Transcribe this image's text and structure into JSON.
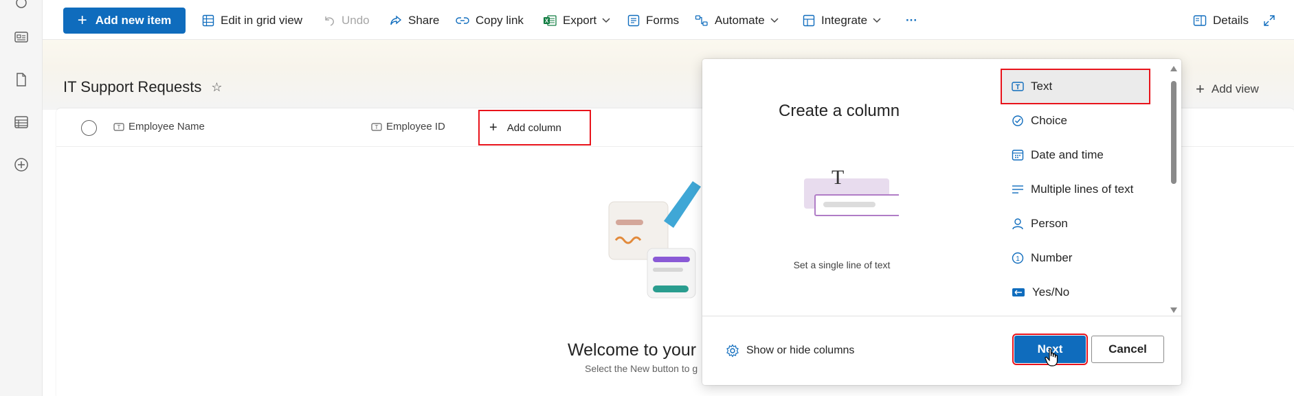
{
  "toolbar": {
    "add_new_item": "Add new item",
    "edit_grid": "Edit in grid view",
    "undo": "Undo",
    "share": "Share",
    "copy_link": "Copy link",
    "export": "Export",
    "forms": "Forms",
    "automate": "Automate",
    "integrate": "Integrate",
    "more": "···",
    "details": "Details"
  },
  "page": {
    "title": "IT Support Requests",
    "add_view": "Add view"
  },
  "list": {
    "columns": [
      "Employee Name",
      "Employee ID"
    ],
    "add_column": "Add column",
    "welcome": "Welcome to your",
    "welcome_sub": "Select the New button to g"
  },
  "panel": {
    "title": "Create a column",
    "description": "Set a single line of text",
    "options": [
      {
        "label": "Text",
        "icon": "text-field-icon",
        "selected": true
      },
      {
        "label": "Choice",
        "icon": "choice-icon"
      },
      {
        "label": "Date and time",
        "icon": "calendar-icon"
      },
      {
        "label": "Multiple lines of text",
        "icon": "multiline-text-icon"
      },
      {
        "label": "Person",
        "icon": "person-icon"
      },
      {
        "label": "Number",
        "icon": "number-icon"
      },
      {
        "label": "Yes/No",
        "icon": "yes-no-icon"
      }
    ],
    "show_hide": "Show or hide columns",
    "next": "Next",
    "cancel": "Cancel"
  },
  "colors": {
    "accent": "#0f6cbd",
    "highlight": "#e8121a"
  }
}
